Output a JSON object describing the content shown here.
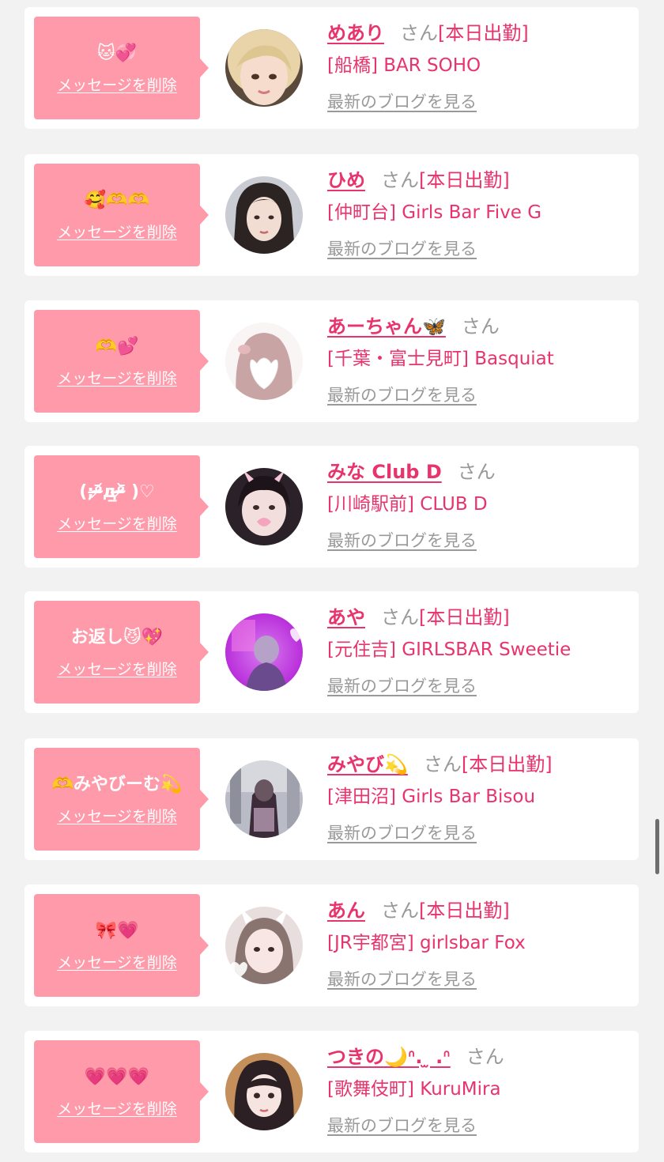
{
  "delete_label": "メッセージを削除",
  "san_label": "さん",
  "blog_label": "最新のブログを見る",
  "colors": {
    "accent": "#e8336d",
    "bubble": "#ff9aaa",
    "muted": "#999999",
    "background": "#f2f2f2"
  },
  "messages": [
    {
      "message": "🐱💞",
      "name": "めあり",
      "status": "[本日出勤]",
      "store": "[船橋] BAR SOHO",
      "avatar": "photo-avatar"
    },
    {
      "message": "🥰🫶🫶",
      "name": "ひめ",
      "status": "[本日出勤]",
      "store": "[仲町台] Girls Bar Five G",
      "avatar": "photo-avatar"
    },
    {
      "message": "🫶💕",
      "name": "あーちゃん🦋",
      "status": "",
      "store": "[千葉・富士見町] Basquiat",
      "avatar": "photo-avatar"
    },
    {
      "message": "(;ᵒ̴̶̷᷄д̲ᵒ̴̶̷᷅ )♡",
      "name": "みな Club D",
      "status": "",
      "store": "[川崎駅前] CLUB D",
      "avatar": "photo-avatar"
    },
    {
      "message": "お返し😼💖",
      "name": "あや",
      "status": "[本日出勤]",
      "store": "[元住吉] GIRLSBAR Sweetie",
      "avatar": "photo-avatar"
    },
    {
      "message": "🫶みやびーむ💫",
      "name": "みやび💫",
      "status": "[本日出勤]",
      "store": "[津田沼] Girls Bar Bisou",
      "avatar": "photo-avatar"
    },
    {
      "message": "🎀💗",
      "name": "あん",
      "status": "[本日出勤]",
      "store": "[JR宇都宮] girlsbar Fox",
      "avatar": "photo-avatar"
    },
    {
      "message": "💗💗💗",
      "name": "つきの🌙ᐢ. ̫ .ᐢ",
      "status": "",
      "store": "[歌舞伎町] KuruMira",
      "avatar": "photo-avatar"
    }
  ]
}
